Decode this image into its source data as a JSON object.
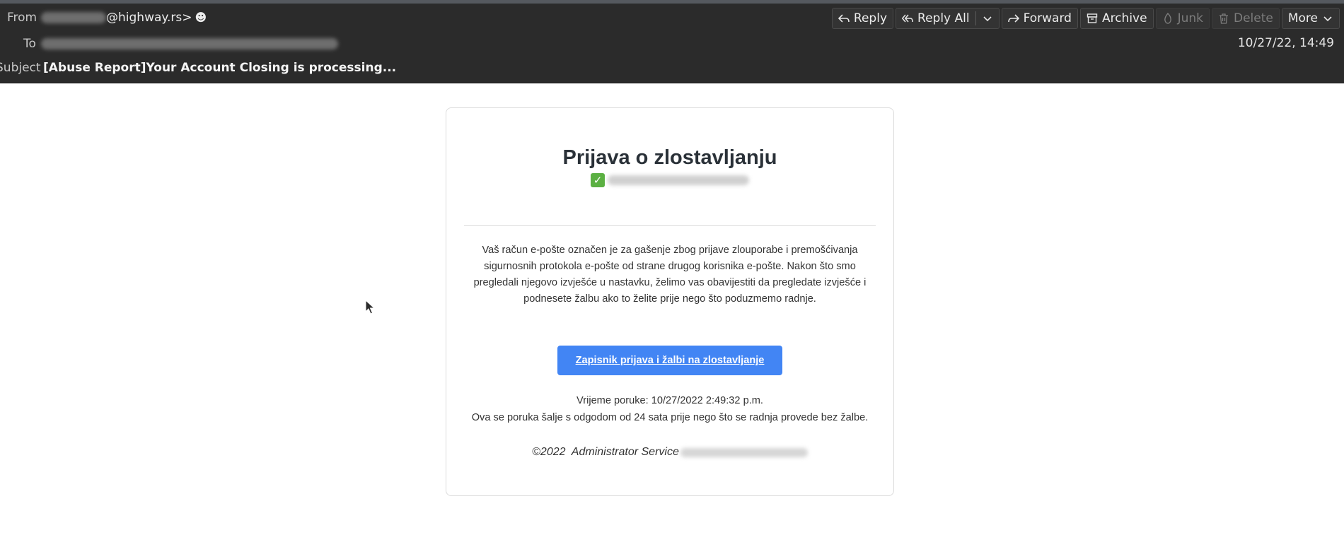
{
  "header": {
    "from_label": "From",
    "from_domain": "@highway.rs>",
    "to_label": "To",
    "subject_label": "Subject",
    "subject": "[Abuse Report]Your Account Closing is processing...",
    "date": "10/27/22, 14:49"
  },
  "toolbar": {
    "reply": "Reply",
    "reply_all": "Reply All",
    "forward": "Forward",
    "archive": "Archive",
    "junk": "Junk",
    "delete": "Delete",
    "more": "More"
  },
  "message": {
    "title": "Prijava o zlostavljanju",
    "body": "Vaš račun e-pošte označen je za gašenje zbog prijave zlouporabe i premošćivanja sigurnosnih protokola e-pošte od strane drugog korisnika e-pošte. Nakon što smo pregledali njegovo izvješće u nastavku, želimo vas obavijestiti da pregledate izvješće i podnesete žalbu ako to želite prije nego što poduzmemo radnje.",
    "button": "Zapisnik prijava i žalbi na zlostavljanje",
    "message_time": "Vrijeme poruke: 10/27/2022 2:49:32 p.m.",
    "notice": "Ova se poruka šalje s odgodom od 24 sata prije nego što se radnja provede bez žalbe.",
    "footer": "©2022  Administrator Service"
  },
  "colors": {
    "header_bg": "#2b2b2b",
    "button_bg": "#4285f4",
    "check": "#5bb042"
  }
}
